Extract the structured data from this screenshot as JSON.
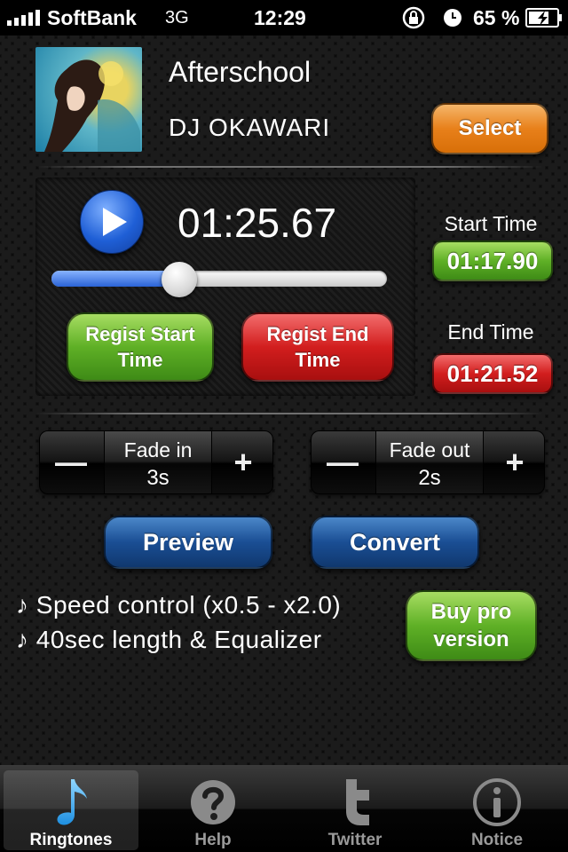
{
  "status_bar": {
    "carrier": "SoftBank",
    "network": "3G",
    "time": "12:29",
    "battery": "65 %",
    "icons": [
      "signal-icon",
      "rotation-lock-icon",
      "alarm-icon",
      "battery-charging-icon"
    ]
  },
  "track": {
    "title": "Afterschool",
    "artist": "DJ OKAWARI",
    "select_label": "Select"
  },
  "player": {
    "current_time": "01:25.67",
    "progress": 0.38,
    "play_icon": "play-icon",
    "regist_start_line1": "Regist Start",
    "regist_start_line2": "Time",
    "regist_end_line1": "Regist End",
    "regist_end_line2": "Time"
  },
  "times": {
    "start_label": "Start Time",
    "start_value": "01:17.90",
    "end_label": "End Time",
    "end_value": "01:21.52"
  },
  "fade": {
    "in_label": "Fade in",
    "in_value": "3s",
    "out_label": "Fade out",
    "out_value": "2s",
    "minus": "—",
    "plus": "+"
  },
  "actions": {
    "preview": "Preview",
    "convert": "Convert"
  },
  "promo": {
    "feature1": "♪ Speed control (x0.5 - x2.0)",
    "feature2": "♪ 40sec length & Equalizer",
    "buy_line1": "Buy pro",
    "buy_line2": "version"
  },
  "tabs": [
    {
      "label": "Ringtones",
      "icon": "music-note-icon",
      "active": true
    },
    {
      "label": "Help",
      "icon": "question-icon",
      "active": false
    },
    {
      "label": "Twitter",
      "icon": "twitter-icon",
      "active": false
    },
    {
      "label": "Notice",
      "icon": "info-icon",
      "active": false
    }
  ],
  "colors": {
    "select": "#e8801a",
    "green": "#5fb026",
    "red": "#d21e1e",
    "blue": "#1a4e94",
    "active_tab_icon": "#2aa9f3"
  }
}
